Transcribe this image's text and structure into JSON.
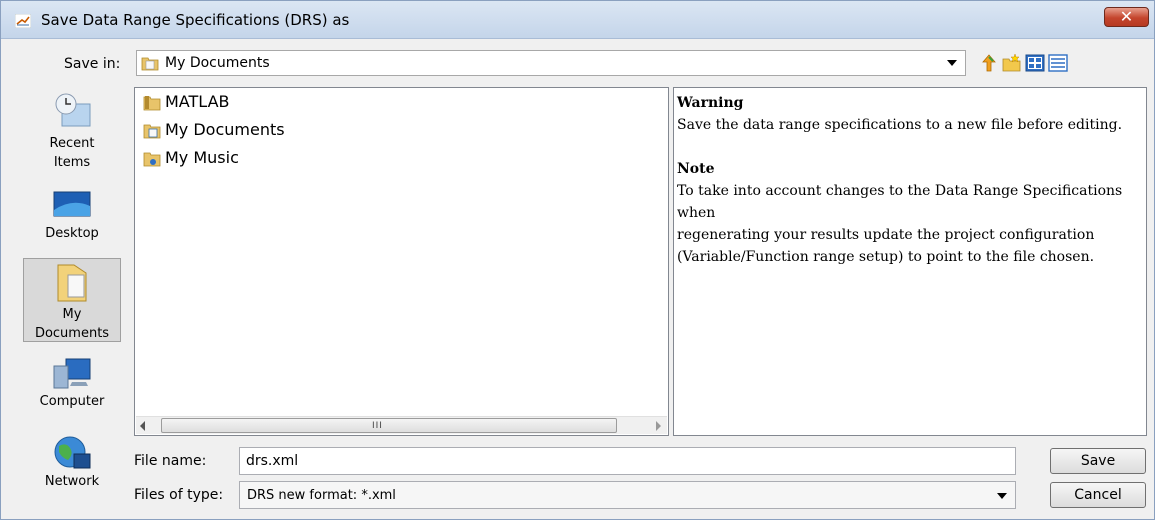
{
  "window": {
    "title": "Save Data Range Specifications (DRS) as",
    "close_glyph": "✕"
  },
  "save_in": {
    "label": "Save in:",
    "value": "My Documents"
  },
  "places": [
    {
      "label_line1": "Recent",
      "label_line2": "Items",
      "icon": "recent-items-icon"
    },
    {
      "label_line1": "Desktop",
      "label_line2": "",
      "icon": "desktop-icon"
    },
    {
      "label_line1": "My",
      "label_line2": "Documents",
      "icon": "my-documents-icon"
    },
    {
      "label_line1": "Computer",
      "label_line2": "",
      "icon": "computer-icon"
    },
    {
      "label_line1": "Network",
      "label_line2": "",
      "icon": "network-icon"
    }
  ],
  "files": [
    {
      "name": "MATLAB",
      "icon": "folder-icon"
    },
    {
      "name": "My Documents",
      "icon": "documents-folder-icon"
    },
    {
      "name": "My Music",
      "icon": "music-folder-icon"
    }
  ],
  "scrollbar": {
    "grip": "III"
  },
  "description": {
    "warning_heading": "Warning",
    "warning_text": "Save the data range specifications to a new file before editing.",
    "note_heading": "Note",
    "note_line1": "To take into account changes to the Data Range Specifications when",
    "note_line2": "regenerating your results update the project configuration",
    "note_line3": "(Variable/Function range setup) to point to the file chosen."
  },
  "file_name": {
    "label": "File name:",
    "value": "drs.xml"
  },
  "file_type": {
    "label": "Files of type:",
    "value": "DRS new format: *.xml"
  },
  "buttons": {
    "save": "Save",
    "cancel": "Cancel"
  },
  "colors": {
    "titlebar": "#c4d5ea",
    "close": "#c4452d",
    "window_bg": "#f0f0f0",
    "selection": "#d9d9d9"
  }
}
